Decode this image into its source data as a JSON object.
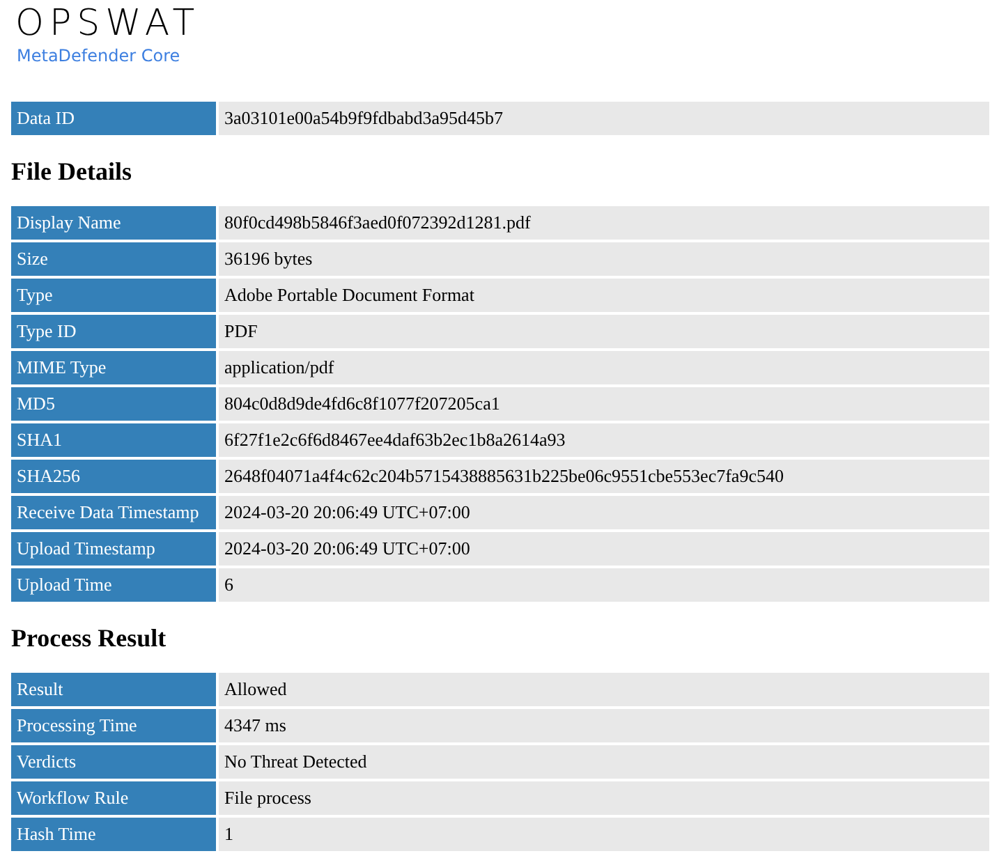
{
  "header": {
    "logo": "OPSWAT",
    "product": "MetaDefender Core"
  },
  "data_id": {
    "label": "Data ID",
    "value": "3a03101e00a54b9f9fdbabd3a95d45b7"
  },
  "sections": [
    {
      "title": "File Details",
      "rows": [
        {
          "label": "Display Name",
          "value": "80f0cd498b5846f3aed0f072392d1281.pdf"
        },
        {
          "label": "Size",
          "value": "36196 bytes"
        },
        {
          "label": "Type",
          "value": "Adobe Portable Document Format"
        },
        {
          "label": "Type ID",
          "value": "PDF"
        },
        {
          "label": "MIME Type",
          "value": "application/pdf"
        },
        {
          "label": "MD5",
          "value": "804c0d8d9de4fd6c8f1077f207205ca1"
        },
        {
          "label": "SHA1",
          "value": "6f27f1e2c6f6d8467ee4daf63b2ec1b8a2614a93"
        },
        {
          "label": "SHA256",
          "value": "2648f04071a4f4c62c204b5715438885631b225be06c9551cbe553ec7fa9c540"
        },
        {
          "label": "Receive Data Timestamp",
          "value": "2024-03-20 20:06:49 UTC+07:00"
        },
        {
          "label": "Upload Timestamp",
          "value": "2024-03-20 20:06:49 UTC+07:00"
        },
        {
          "label": "Upload Time",
          "value": "6"
        }
      ]
    },
    {
      "title": "Process Result",
      "rows": [
        {
          "label": "Result",
          "value": "Allowed"
        },
        {
          "label": "Processing Time",
          "value": "4347 ms"
        },
        {
          "label": "Verdicts",
          "value": "No Threat Detected"
        },
        {
          "label": "Workflow Rule",
          "value": "File process"
        },
        {
          "label": "Hash Time",
          "value": "1"
        }
      ]
    }
  ]
}
